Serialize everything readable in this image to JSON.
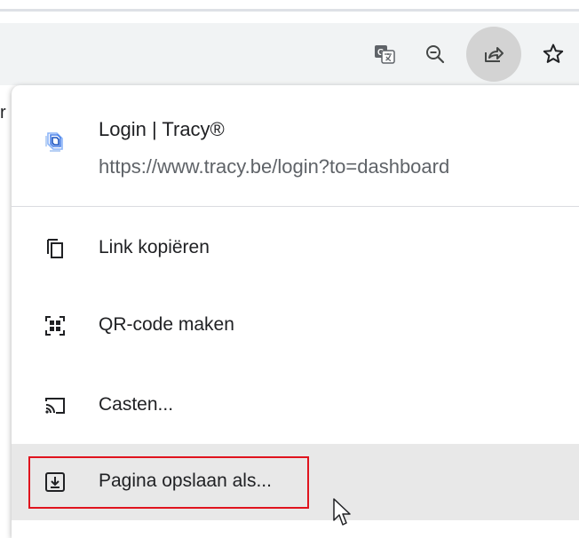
{
  "toolbar": {
    "icons": [
      "translate-icon",
      "zoom-out-icon",
      "share-icon",
      "bookmark-star-icon"
    ]
  },
  "page": {
    "partial_text": "r"
  },
  "share_menu": {
    "site": {
      "title": "Login | Tracy®",
      "url": "https://www.tracy.be/login?to=dashboard",
      "icon": "tracy-logo-icon"
    },
    "items": [
      {
        "label": "Link kopiëren",
        "icon": "copy-link-icon"
      },
      {
        "label": "QR-code maken",
        "icon": "qr-code-icon"
      },
      {
        "label": "Casten...",
        "icon": "cast-icon"
      },
      {
        "label": "Pagina opslaan als...",
        "icon": "save-page-icon"
      }
    ]
  },
  "colors": {
    "highlight": "#e0141e",
    "hover_bg": "#e8e8e8",
    "toolbar_bg": "#f1f3f4",
    "active_button_bg": "#d3d3d3"
  }
}
